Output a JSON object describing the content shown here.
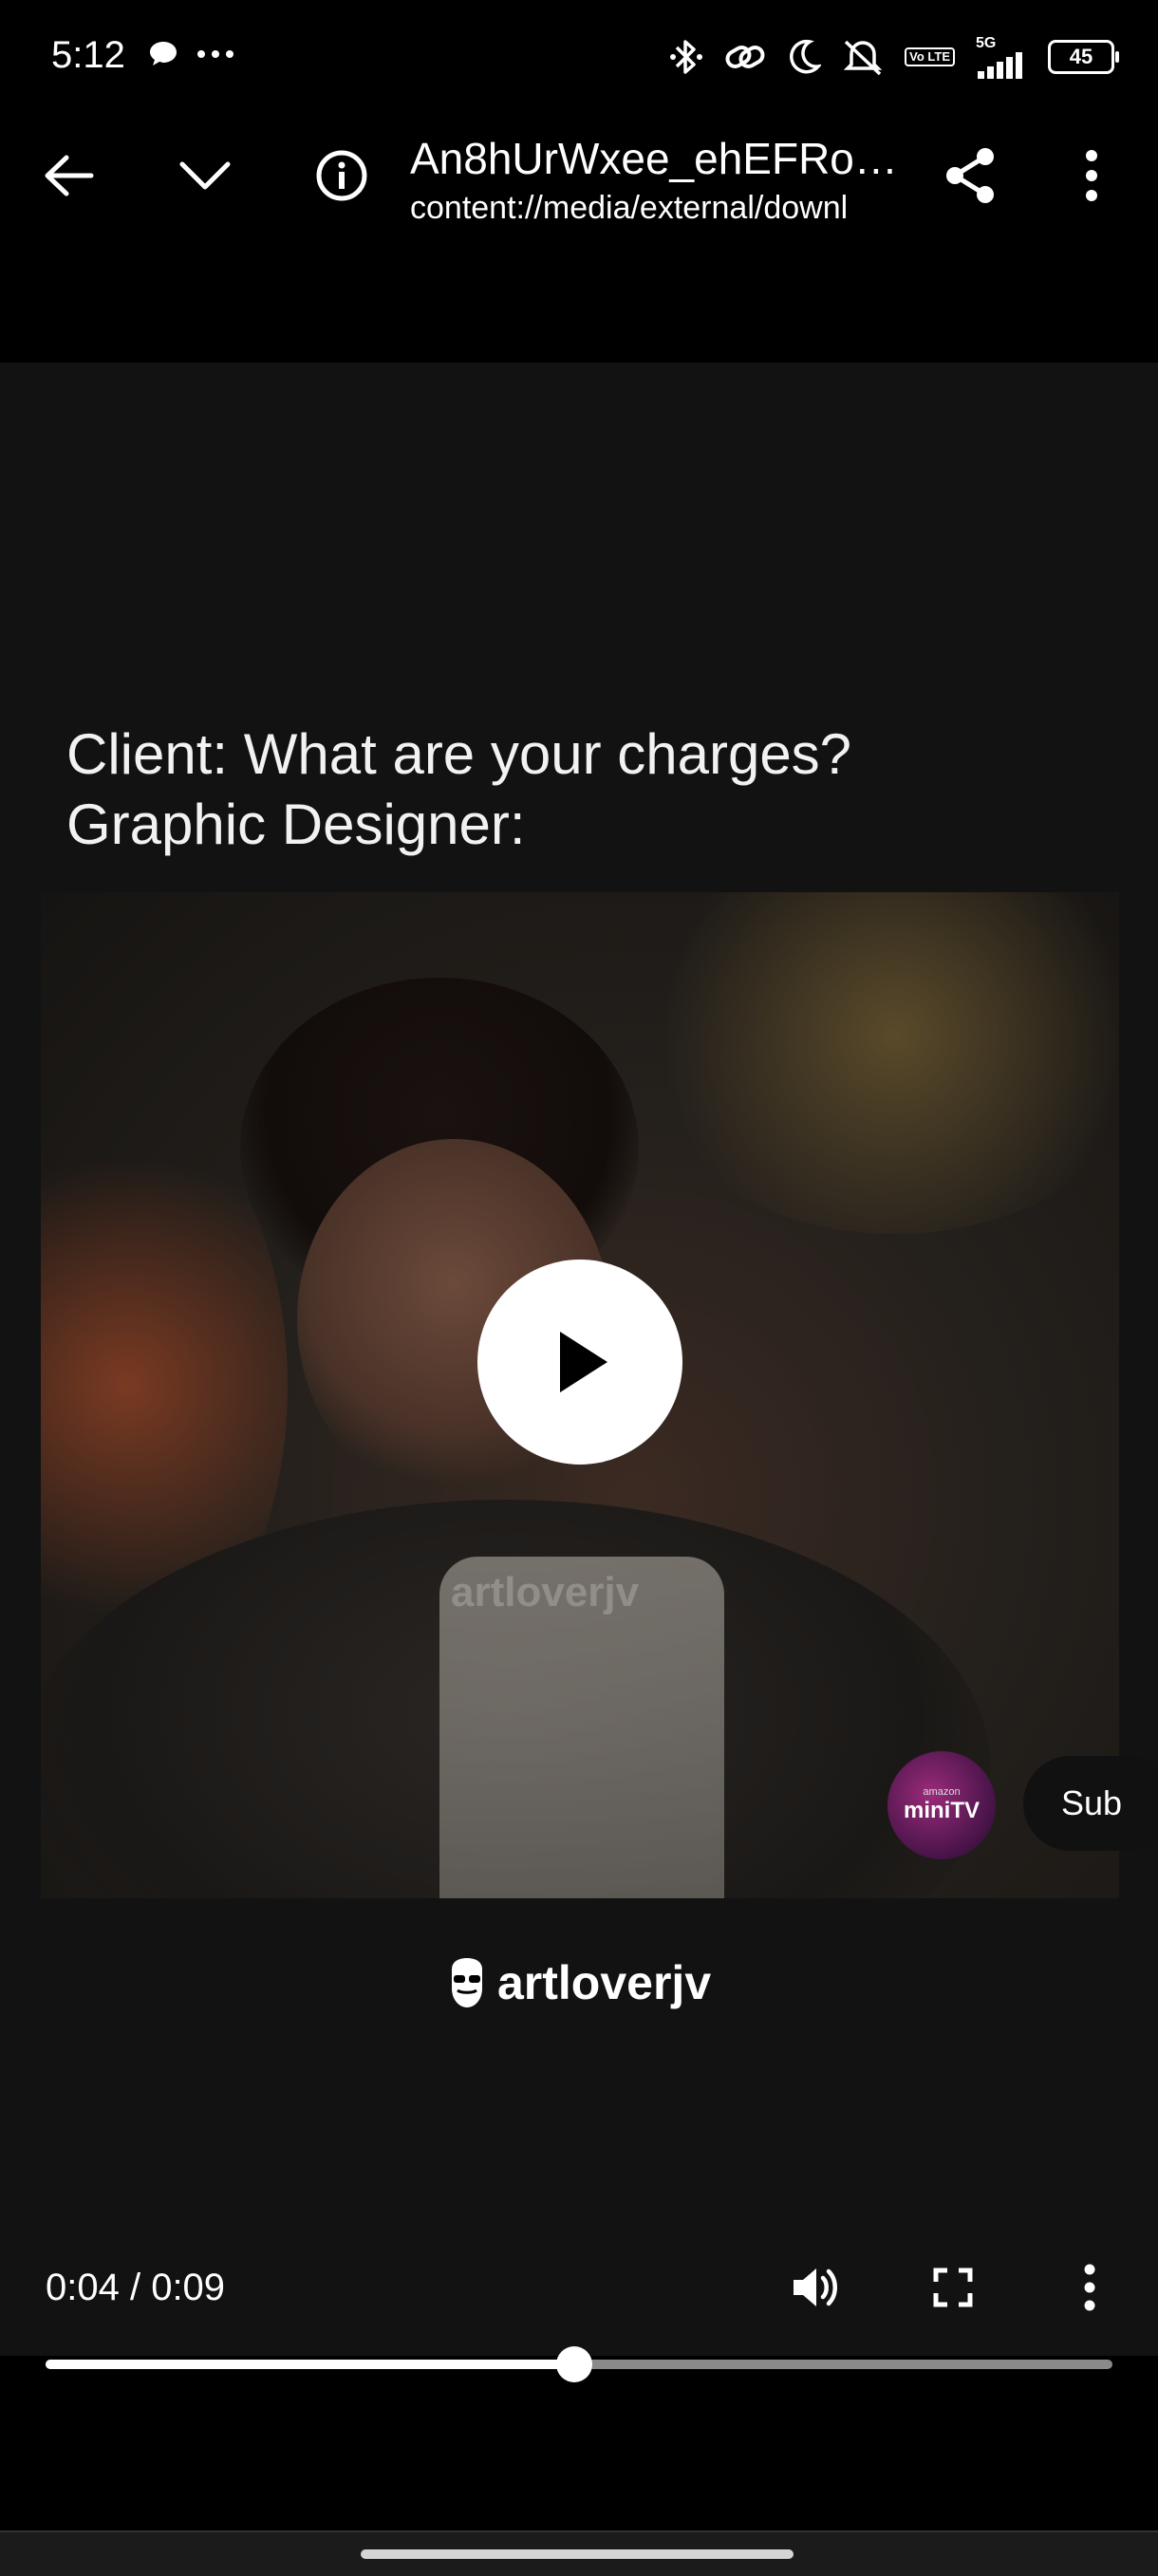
{
  "status_bar": {
    "time": "5:12",
    "network": "5G",
    "volte": "Vo LTE",
    "battery": "45"
  },
  "app_bar": {
    "title": "An8hUrWxee_ehEFRoc...",
    "subtitle": "content://media/external/downl",
    "icons": [
      "back-arrow-icon",
      "chevron-down-icon",
      "info-icon",
      "share-icon",
      "more-vert-icon"
    ]
  },
  "video": {
    "caption_line1": "Client: What are your charges?",
    "caption_line2": "Graphic Designer:",
    "watermark": "artloverjv",
    "minitv_small": "amazon",
    "minitv_brand": "miniTV",
    "subscribe_label": "Sub",
    "logo_text": "artloverjv"
  },
  "controls": {
    "timecode": "0:04 / 0:09",
    "progress_fraction": 0.4956
  },
  "colors": {
    "background": "#121212",
    "bars": "#000000",
    "seek_track": "#8a8a8a",
    "seek_fill": "#ffffff"
  }
}
